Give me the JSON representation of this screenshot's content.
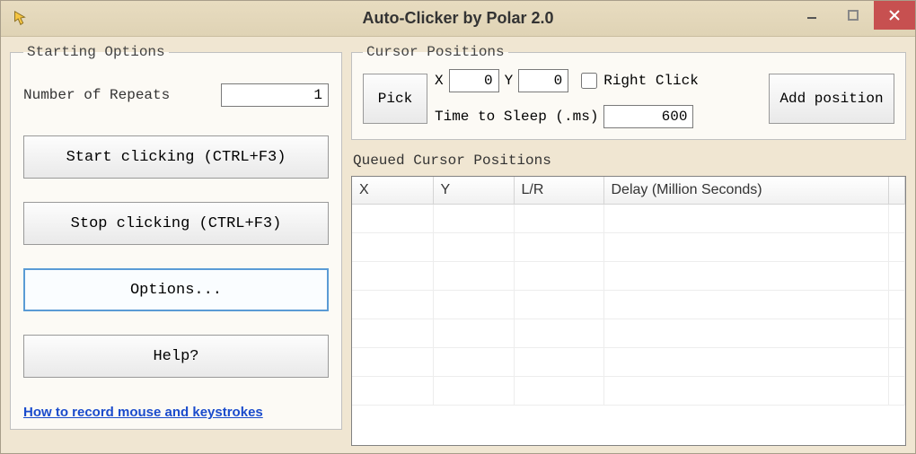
{
  "window": {
    "title": "Auto-Clicker by Polar 2.0"
  },
  "starting": {
    "legend": "Starting Options",
    "repeats_label": "Number of Repeats",
    "repeats_value": "1",
    "start_btn": "Start clicking (CTRL+F3)",
    "stop_btn": "Stop clicking (CTRL+F3)",
    "options_btn": "Options...",
    "help_btn": "Help?",
    "link": "How to record mouse and keystrokes"
  },
  "cursor": {
    "legend": "Cursor Positions",
    "pick_btn": "Pick",
    "x_label": "X",
    "x_value": "0",
    "y_label": "Y",
    "y_value": "0",
    "right_click_label": "Right Click",
    "right_click_checked": false,
    "sleep_label": "Time to Sleep (.ms)",
    "sleep_value": "600",
    "add_btn": "Add position"
  },
  "queued": {
    "label": "Queued Cursor Positions",
    "columns": [
      "X",
      "Y",
      "L/R",
      "Delay (Million Seconds)"
    ],
    "rows": []
  }
}
